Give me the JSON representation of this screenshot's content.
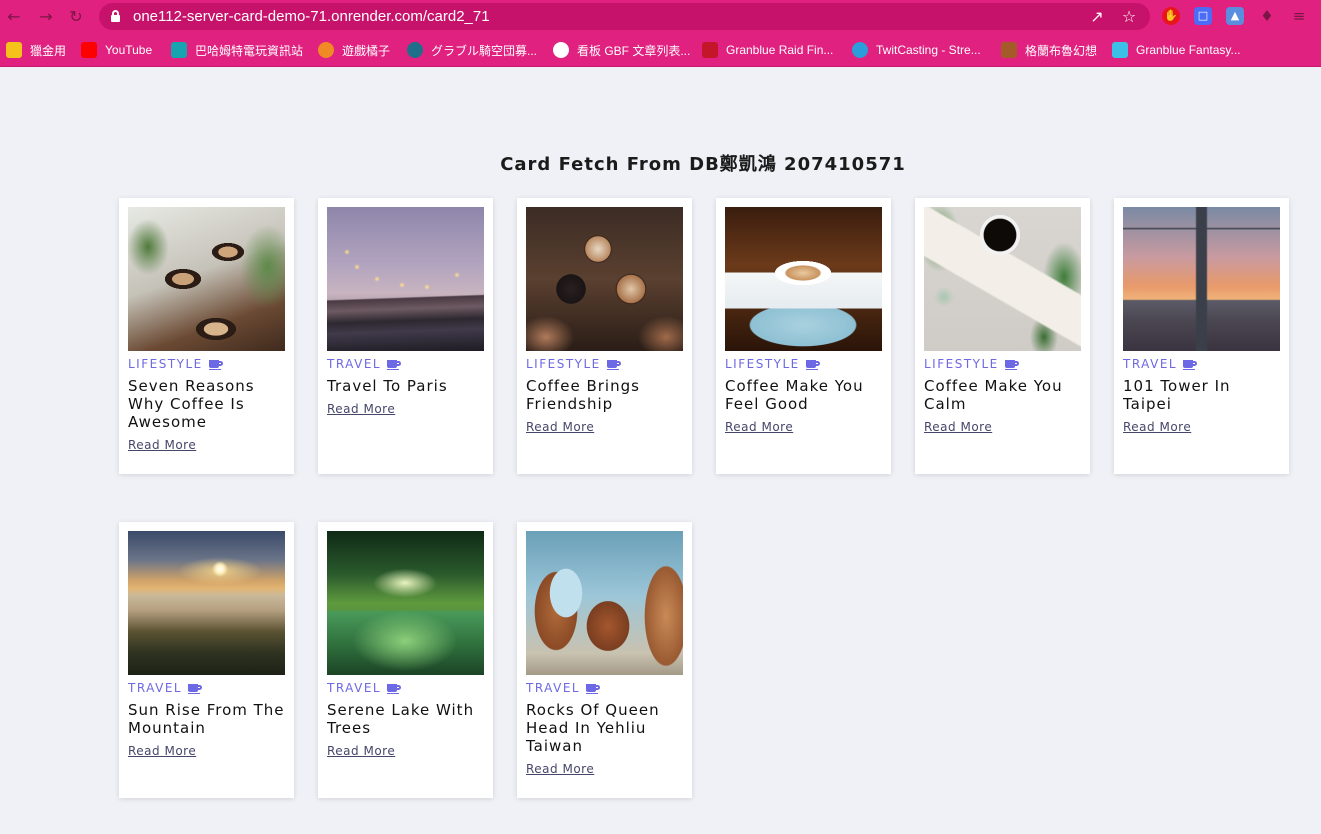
{
  "browser": {
    "url": "one112-server-card-demo-71.onrender.com/card2_71",
    "bookmarks": [
      {
        "label": "獵金用",
        "icon": "joker-icon",
        "color": "#f4c21b"
      },
      {
        "label": "YouTube",
        "icon": "youtube-icon",
        "color": "#ff0000"
      },
      {
        "label": "巴哈姆特電玩資訊站",
        "icon": "bahamut-icon",
        "color": "#17a3b0"
      },
      {
        "label": "遊戲橘子",
        "icon": "gamania-icon",
        "color": "#f08a24"
      },
      {
        "label": "グラブル騎空団募...",
        "icon": "globe-icon",
        "color": "#1f6f8b"
      },
      {
        "label": "看板 GBF 文章列表...",
        "icon": "ptt-icon",
        "color": "#ffffff"
      },
      {
        "label": "Granblue Raid Fin...",
        "icon": "raid-finder-icon",
        "color": "#c4162a"
      },
      {
        "label": "TwitCasting - Stre...",
        "icon": "twitcasting-icon",
        "color": "#2d9cdb"
      },
      {
        "label": "格蘭布魯幻想",
        "icon": "gbf-icon",
        "color": "#a55a2a"
      },
      {
        "label": "Granblue Fantasy...",
        "icon": "star-icon",
        "color": "#3cc0e8"
      }
    ]
  },
  "page": {
    "title": "Card Fetch From DB鄭凱鴻 207410571"
  },
  "cards": [
    {
      "category": "LIFESTYLE",
      "title": "Seven Reasons Why Coffee Is Awesome",
      "link": "Read More",
      "image": "coffee-cups-with-plants"
    },
    {
      "category": "TRAVEL",
      "title": "Travel To Paris",
      "link": "Read More",
      "image": "paris-bridge-at-dusk"
    },
    {
      "category": "LIFESTYLE",
      "title": "Coffee Brings Friendship",
      "link": "Read More",
      "image": "hands-toasting-coffee"
    },
    {
      "category": "LIFESTYLE",
      "title": "Coffee Make You Feel Good",
      "link": "Read More",
      "image": "latte-cup-on-saucer"
    },
    {
      "category": "LIFESTYLE",
      "title": "Coffee Make You Calm",
      "link": "Read More",
      "image": "coffee-with-leaves-and-card"
    },
    {
      "category": "TRAVEL",
      "title": "101 Tower In Taipei",
      "link": "Read More",
      "image": "taipei-101-skyline"
    },
    {
      "category": "TRAVEL",
      "title": "Sun Rise From The Mountain",
      "link": "Read More",
      "image": "mountain-sunrise-sea-of-clouds"
    },
    {
      "category": "TRAVEL",
      "title": "Serene Lake With Trees",
      "link": "Read More",
      "image": "green-lake-tree-tunnel"
    },
    {
      "category": "TRAVEL",
      "title": "Rocks Of Queen Head In Yehliu Taiwan",
      "link": "Read More",
      "image": "yehliu-rock-formations"
    }
  ]
}
